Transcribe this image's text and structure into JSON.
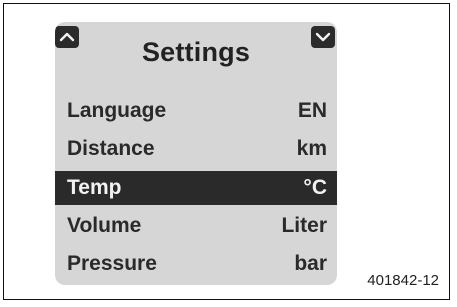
{
  "header": {
    "title": "Settings"
  },
  "icons": {
    "up": "chevron-up-icon",
    "down": "chevron-down-icon"
  },
  "settings": [
    {
      "label": "Language",
      "value": "EN",
      "selected": false
    },
    {
      "label": "Distance",
      "value": "km",
      "selected": false
    },
    {
      "label": "Temp",
      "value": "°C",
      "selected": true
    },
    {
      "label": "Volume",
      "value": "Liter",
      "selected": false
    },
    {
      "label": "Pressure",
      "value": "bar",
      "selected": false
    }
  ],
  "figure_code": "401842-12",
  "colors": {
    "panel": "#d6d6d6",
    "selected_bg": "#2a2a2a",
    "text": "#2a2a2a"
  }
}
